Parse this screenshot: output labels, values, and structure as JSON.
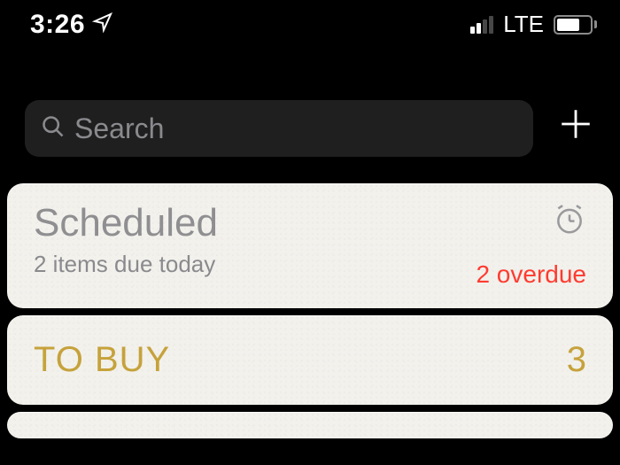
{
  "status": {
    "time": "3:26",
    "network": "LTE"
  },
  "search": {
    "placeholder": "Search"
  },
  "scheduled": {
    "title": "Scheduled",
    "subtitle": "2 items due today",
    "overdue": "2 overdue"
  },
  "lists": [
    {
      "name": "TO BUY",
      "count": "3"
    }
  ]
}
